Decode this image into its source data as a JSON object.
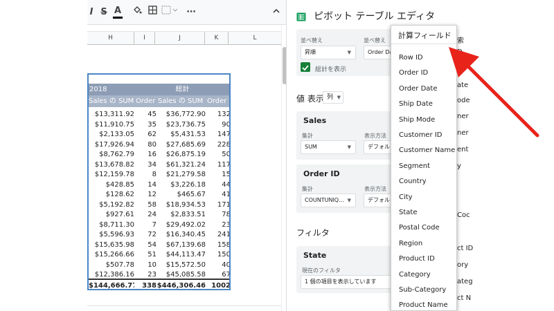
{
  "toolbar": {
    "italic": "I",
    "strike": "S",
    "text_color": "A",
    "more": "⋯",
    "collapse": "^"
  },
  "columns": [
    "H",
    "I",
    "J",
    "K",
    "L"
  ],
  "pivot": {
    "header1": [
      "2018",
      "総計"
    ],
    "header2": [
      "Sales の SUM",
      "Order II",
      "Sales の SUM",
      "Order II"
    ],
    "rows": [
      [
        "$13,311.92",
        "45",
        "$36,772.90",
        "132"
      ],
      [
        "$11,910.75",
        "35",
        "$23,736.75",
        "90"
      ],
      [
        "$2,133.05",
        "62",
        "$5,431.53",
        "147"
      ],
      [
        "$17,926.94",
        "80",
        "$27,685.69",
        "228"
      ],
      [
        "$8,762.79",
        "16",
        "$26,875.19",
        "50"
      ],
      [
        "$13,678.82",
        "34",
        "$61,321.24",
        "117"
      ],
      [
        "$12,159.78",
        "8",
        "$21,279.58",
        "15"
      ],
      [
        "$428.85",
        "14",
        "$3,226.18",
        "44"
      ],
      [
        "$128.62",
        "12",
        "$465.67",
        "41"
      ],
      [
        "$5,192.82",
        "58",
        "$18,934.53",
        "171"
      ],
      [
        "$927.61",
        "24",
        "$2,833.51",
        "78"
      ],
      [
        "$8,711.30",
        "7",
        "$29,492.02",
        "23"
      ],
      [
        "$5,596.93",
        "72",
        "$16,340.45",
        "241"
      ],
      [
        "$15,635.98",
        "54",
        "$67,139.68",
        "158"
      ],
      [
        "$15,266.66",
        "51",
        "$44,113.47",
        "150"
      ],
      [
        "$507.78",
        "10",
        "$15,572.50",
        "40"
      ],
      [
        "$12,386.16",
        "23",
        "$45,085.58",
        "67"
      ]
    ],
    "total": [
      "$144,666.77",
      "338",
      "$446,306.46",
      "1002"
    ]
  },
  "panel": {
    "title": "ピボット テーブル エディタ",
    "sort_label_1": "並べ替え",
    "sort_label_2": "並べ替え",
    "sort_value_1": "昇順",
    "sort_value_2": "Order Dat",
    "show_total": "総計を表示",
    "values_label": "値 表示:",
    "values_mode": "列",
    "sales_card": {
      "title": "Sales",
      "agg_label": "集計",
      "agg_value": "SUM",
      "display_label": "表示方法",
      "display_value": "デフォル"
    },
    "order_card": {
      "title": "Order ID",
      "agg_label": "集計",
      "agg_value": "COUNTUNIQ...",
      "display_label": "表示方法",
      "display_value": "デフォル"
    },
    "filter_title": "フィルタ",
    "state_card": {
      "title": "State",
      "filter_label": "現在のフィルタ",
      "filter_value": "1 個の項目を表示しています"
    }
  },
  "dropdown": {
    "calc_field": "計算フィールド",
    "items": [
      "Row ID",
      "Order ID",
      "Order Date",
      "Ship Date",
      "Ship Mode",
      "Customer ID",
      "Customer Name",
      "Segment",
      "Country",
      "City",
      "State",
      "Postal Code",
      "Region",
      "Product ID",
      "Category",
      "Sub-Category",
      "Product Name"
    ]
  },
  "behind": [
    "索",
    "D",
    "ate",
    "ode",
    "ner",
    "ner",
    "ent",
    "y",
    "Coc",
    "ct ID",
    "ory",
    "ateg",
    "ct N"
  ],
  "colors": {
    "arrow": "#e8231a",
    "pivot_border": "#4a86c5",
    "sheets_green": "#0f9d58",
    "checkbox_green": "#188038"
  }
}
